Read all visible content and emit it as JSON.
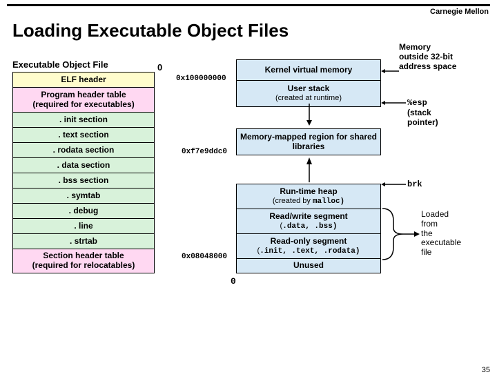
{
  "brand": "Carnegie Mellon",
  "title": "Loading Executable Object Files",
  "slide_number": "35",
  "elf": {
    "title": "Executable Object File",
    "zero_label": "0",
    "sections": [
      {
        "label": "ELF header",
        "color": "yellow",
        "h": 22
      },
      {
        "label": "Program header table\n(required for executables)",
        "color": "pink",
        "h": 36
      },
      {
        "label": ". init section",
        "color": "green",
        "h": 22
      },
      {
        "label": ". text section",
        "color": "green",
        "h": 22
      },
      {
        "label": ". rodata section",
        "color": "green",
        "h": 22
      },
      {
        "label": ". data section",
        "color": "green",
        "h": 22
      },
      {
        "label": ". bss section",
        "color": "green",
        "h": 22
      },
      {
        "label": ". symtab",
        "color": "green",
        "h": 22
      },
      {
        "label": ". debug",
        "color": "green",
        "h": 22
      },
      {
        "label": ". line",
        "color": "green",
        "h": 22
      },
      {
        "label": ". strtab",
        "color": "green",
        "h": 22
      },
      {
        "label": "Section header table\n(required for relocatables)",
        "color": "pink",
        "h": 36
      }
    ]
  },
  "memory": {
    "regions": [
      {
        "label": "Kernel virtual memory",
        "color": "blue",
        "h": 30
      },
      {
        "label": "User stack\n(created at runtime)",
        "color": "blue",
        "h": 38
      },
      {
        "label": "",
        "color": "gap",
        "h": 32
      },
      {
        "label": "Memory-mapped region for shared libraries",
        "color": "blue",
        "h": 38
      },
      {
        "label": "",
        "color": "gap",
        "h": 42
      },
      {
        "label": "Run-time heap\n(created by ",
        "mono_suffix": "malloc)",
        "color": "blue",
        "h": 36
      },
      {
        "label": "Read/write segment\n(",
        "mono_suffix": ".data, .bss)",
        "color": "blue",
        "h": 36
      },
      {
        "label": "Read-only segment\n(",
        "mono_suffix": ".init, .text, .rodata)",
        "color": "blue",
        "h": 36
      },
      {
        "label": "Unused",
        "color": "blue",
        "h": 22
      }
    ],
    "addresses": {
      "top": "0x100000000",
      "shared": "0xf7e9ddc0",
      "rw_bottom": "0x08048000",
      "bottom": "0"
    }
  },
  "annotations": {
    "kernel_note": "Memory\noutside 32-bit\naddress space",
    "esp": "%esp",
    "esp_note": "(stack\npointer)",
    "brk": "brk",
    "loaded_note": "Loaded\nfrom\nthe\nexecutable\nfile"
  }
}
